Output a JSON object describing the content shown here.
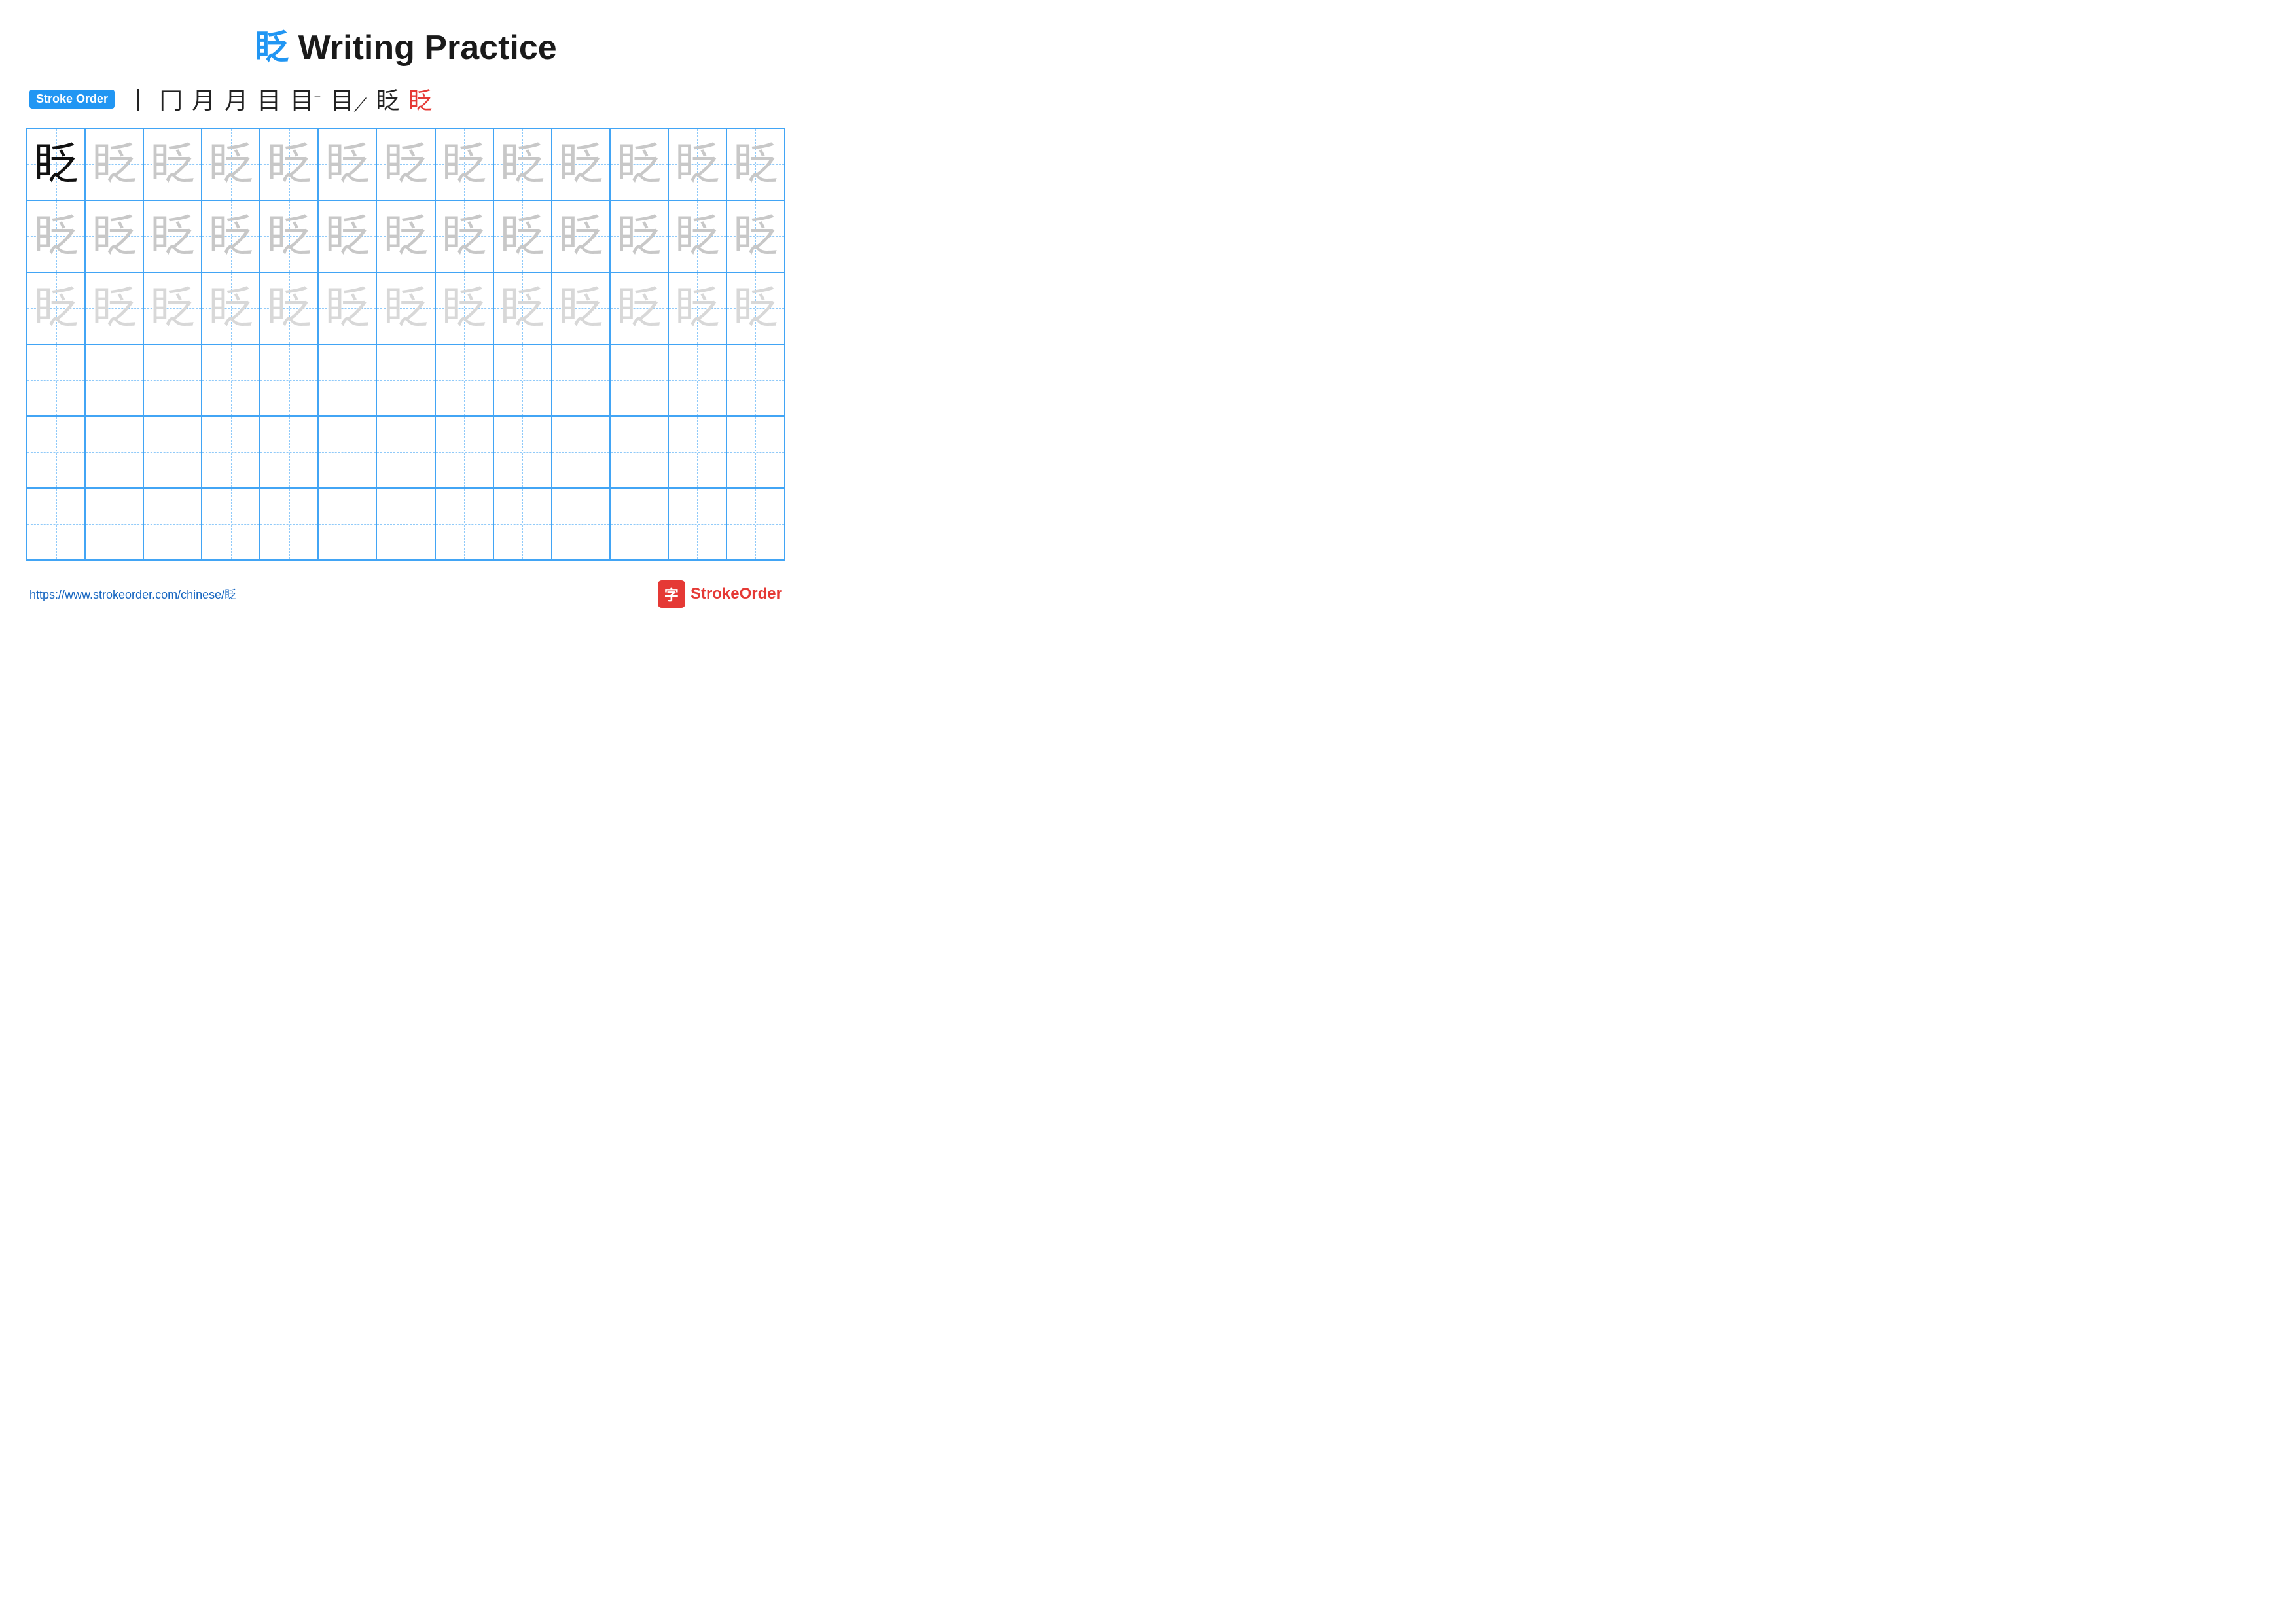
{
  "title": {
    "char": "眨",
    "text": " Writing Practice"
  },
  "stroke_order": {
    "badge": "Stroke Order",
    "strokes": [
      "丨",
      "冂",
      "月",
      "月",
      "目",
      "目⁻",
      "目丿",
      "眨",
      "眨"
    ]
  },
  "grid": {
    "rows": 6,
    "cols": 13,
    "char": "眨",
    "cells": [
      {
        "row": 0,
        "col": 0,
        "style": "dark"
      },
      {
        "row": 0,
        "col": 1,
        "style": "light-gray"
      },
      {
        "row": 0,
        "col": 2,
        "style": "light-gray"
      },
      {
        "row": 0,
        "col": 3,
        "style": "light-gray"
      },
      {
        "row": 0,
        "col": 4,
        "style": "light-gray"
      },
      {
        "row": 0,
        "col": 5,
        "style": "light-gray"
      },
      {
        "row": 0,
        "col": 6,
        "style": "light-gray"
      },
      {
        "row": 0,
        "col": 7,
        "style": "light-gray"
      },
      {
        "row": 0,
        "col": 8,
        "style": "light-gray"
      },
      {
        "row": 0,
        "col": 9,
        "style": "light-gray"
      },
      {
        "row": 0,
        "col": 10,
        "style": "light-gray"
      },
      {
        "row": 0,
        "col": 11,
        "style": "light-gray"
      },
      {
        "row": 0,
        "col": 12,
        "style": "light-gray"
      },
      {
        "row": 1,
        "col": 0,
        "style": "light-gray"
      },
      {
        "row": 1,
        "col": 1,
        "style": "light-gray"
      },
      {
        "row": 1,
        "col": 2,
        "style": "light-gray"
      },
      {
        "row": 1,
        "col": 3,
        "style": "light-gray"
      },
      {
        "row": 1,
        "col": 4,
        "style": "light-gray"
      },
      {
        "row": 1,
        "col": 5,
        "style": "light-gray"
      },
      {
        "row": 1,
        "col": 6,
        "style": "light-gray"
      },
      {
        "row": 1,
        "col": 7,
        "style": "light-gray"
      },
      {
        "row": 1,
        "col": 8,
        "style": "light-gray"
      },
      {
        "row": 1,
        "col": 9,
        "style": "light-gray"
      },
      {
        "row": 1,
        "col": 10,
        "style": "light-gray"
      },
      {
        "row": 1,
        "col": 11,
        "style": "light-gray"
      },
      {
        "row": 1,
        "col": 12,
        "style": "light-gray"
      },
      {
        "row": 2,
        "col": 0,
        "style": "very-light"
      },
      {
        "row": 2,
        "col": 1,
        "style": "very-light"
      },
      {
        "row": 2,
        "col": 2,
        "style": "very-light"
      },
      {
        "row": 2,
        "col": 3,
        "style": "very-light"
      },
      {
        "row": 2,
        "col": 4,
        "style": "very-light"
      },
      {
        "row": 2,
        "col": 5,
        "style": "very-light"
      },
      {
        "row": 2,
        "col": 6,
        "style": "very-light"
      },
      {
        "row": 2,
        "col": 7,
        "style": "very-light"
      },
      {
        "row": 2,
        "col": 8,
        "style": "very-light"
      },
      {
        "row": 2,
        "col": 9,
        "style": "very-light"
      },
      {
        "row": 2,
        "col": 10,
        "style": "very-light"
      },
      {
        "row": 2,
        "col": 11,
        "style": "very-light"
      },
      {
        "row": 2,
        "col": 12,
        "style": "very-light"
      }
    ]
  },
  "footer": {
    "url": "https://www.strokeorder.com/chinese/眨",
    "logo_char": "字",
    "logo_text": "StrokeOrder"
  }
}
